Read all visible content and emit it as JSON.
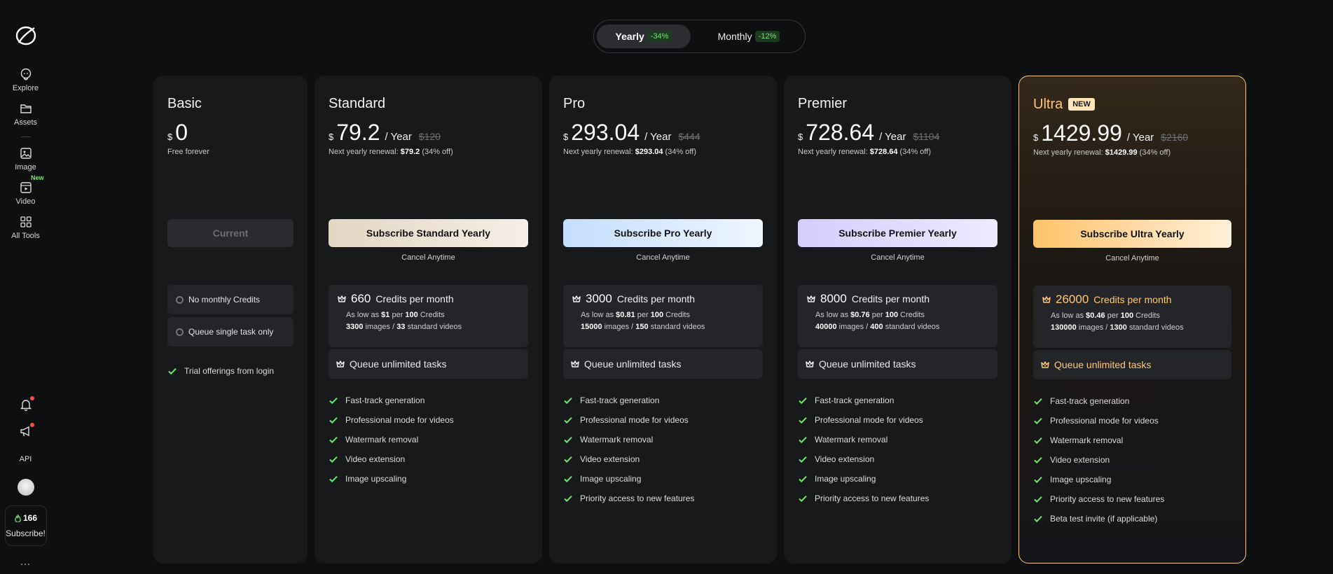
{
  "sidebar": {
    "items": [
      {
        "label": "Explore",
        "icon": "explore-icon"
      },
      {
        "label": "Assets",
        "icon": "folder-icon"
      },
      {
        "label": "Image",
        "icon": "image-icon"
      },
      {
        "label": "Video",
        "icon": "video-icon",
        "badge": "New"
      },
      {
        "label": "All Tools",
        "icon": "grid-icon"
      }
    ],
    "api_label": "API",
    "credits": "166",
    "subscribe_label": "Subscribe!",
    "more_label": "..."
  },
  "toggle": {
    "yearly_label": "Yearly",
    "yearly_discount": "-34%",
    "monthly_label": "Monthly",
    "monthly_discount": "-12%"
  },
  "colors": {
    "accent_green": "#6ee96a",
    "ultra_gold": "#ffc77a",
    "ultra_border": "#f3c98a"
  },
  "plans": [
    {
      "name": "Basic",
      "currency": "$",
      "price": "0",
      "note": "Free forever",
      "button": "Current",
      "features": [
        "No monthly Credits",
        "Queue single task only"
      ],
      "list": [
        "Trial offerings from login"
      ]
    },
    {
      "name": "Standard",
      "currency": "$",
      "price": "79.2",
      "period": "/ Year",
      "original": "$120",
      "renewal_label": "Next yearly renewal:",
      "renewal_price": "$79.2",
      "renewal_off": "(34% off)",
      "button": "Subscribe Standard Yearly",
      "cancel": "Cancel Anytime",
      "credits": "660",
      "credits_label": "Credits per month",
      "low_a": "As low as",
      "low_price": "$1",
      "low_per": "per",
      "low_count": "100",
      "low_unit": "Credits",
      "images": "3300",
      "images_label": "images /",
      "videos": "33",
      "videos_label": "standard videos",
      "queue": "Queue unlimited tasks",
      "list": [
        "Fast-track generation",
        "Professional mode for videos",
        "Watermark removal",
        "Video extension",
        "Image upscaling"
      ]
    },
    {
      "name": "Pro",
      "currency": "$",
      "price": "293.04",
      "period": "/ Year",
      "original": "$444",
      "renewal_label": "Next yearly renewal:",
      "renewal_price": "$293.04",
      "renewal_off": "(34% off)",
      "button": "Subscribe Pro Yearly",
      "cancel": "Cancel Anytime",
      "credits": "3000",
      "credits_label": "Credits per month",
      "low_a": "As low as",
      "low_price": "$0.81",
      "low_per": "per",
      "low_count": "100",
      "low_unit": "Credits",
      "images": "15000",
      "images_label": "images /",
      "videos": "150",
      "videos_label": "standard videos",
      "queue": "Queue unlimited tasks",
      "list": [
        "Fast-track generation",
        "Professional mode for videos",
        "Watermark removal",
        "Video extension",
        "Image upscaling",
        "Priority access to new features"
      ]
    },
    {
      "name": "Premier",
      "currency": "$",
      "price": "728.64",
      "period": "/ Year",
      "original": "$1104",
      "renewal_label": "Next yearly renewal:",
      "renewal_price": "$728.64",
      "renewal_off": "(34% off)",
      "button": "Subscribe Premier Yearly",
      "cancel": "Cancel Anytime",
      "credits": "8000",
      "credits_label": "Credits per month",
      "low_a": "As low as",
      "low_price": "$0.76",
      "low_per": "per",
      "low_count": "100",
      "low_unit": "Credits",
      "images": "40000",
      "images_label": "images /",
      "videos": "400",
      "videos_label": "standard videos",
      "queue": "Queue unlimited tasks",
      "list": [
        "Fast-track generation",
        "Professional mode for videos",
        "Watermark removal",
        "Video extension",
        "Image upscaling",
        "Priority access to new features"
      ]
    },
    {
      "name": "Ultra",
      "badge": "NEW",
      "currency": "$",
      "price": "1429.99",
      "period": "/ Year",
      "original": "$2160",
      "renewal_label": "Next yearly renewal:",
      "renewal_price": "$1429.99",
      "renewal_off": "(34% off)",
      "button": "Subscribe Ultra Yearly",
      "cancel": "Cancel Anytime",
      "credits": "26000",
      "credits_label": "Credits per month",
      "low_a": "As low as",
      "low_price": "$0.46",
      "low_per": "per",
      "low_count": "100",
      "low_unit": "Credits",
      "images": "130000",
      "images_label": "images /",
      "videos": "1300",
      "videos_label": "standard videos",
      "queue": "Queue unlimited tasks",
      "list": [
        "Fast-track generation",
        "Professional mode for videos",
        "Watermark removal",
        "Video extension",
        "Image upscaling",
        "Priority access to new features",
        "Beta test invite (if applicable)"
      ]
    }
  ]
}
